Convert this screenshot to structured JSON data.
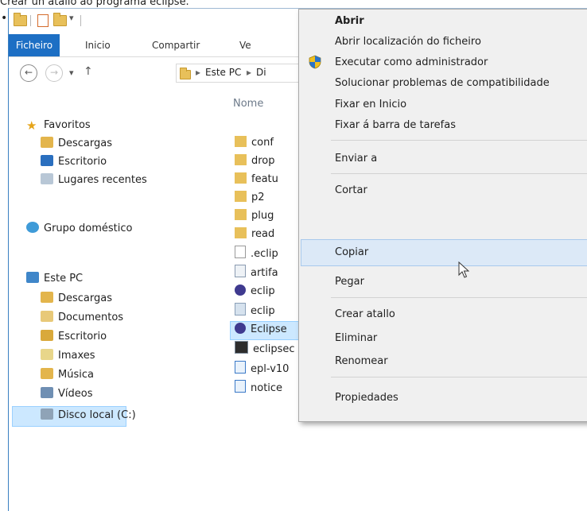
{
  "caption": "Crear un atallo ao programa eclipse.",
  "bullet": "•",
  "ribbon": {
    "tabs": [
      "Ficheiro",
      "Inicio",
      "Compartir",
      "Ve"
    ]
  },
  "address": {
    "segments": [
      "Este PC",
      "Di"
    ]
  },
  "nav": {
    "favorites": "Favoritos",
    "favorites_items": [
      "Descargas",
      "Escritorio",
      "Lugares recentes"
    ],
    "homegroup": "Grupo doméstico",
    "thispc": "Este PC",
    "thispc_items": [
      "Descargas",
      "Documentos",
      "Escritorio",
      "Imaxes",
      "Música",
      "Vídeos",
      "Disco local (C:)"
    ]
  },
  "files": {
    "column_header": "Nome",
    "items": [
      "conf",
      "drop",
      "featu",
      "p2",
      "plug",
      "read",
      ".eclip",
      "artifa",
      "eclip",
      "eclip",
      "Eclipse",
      "eclipsec",
      "epl-v10",
      "notice"
    ]
  },
  "menu": {
    "items": [
      "Abrir",
      "Abrir localización do ficheiro",
      "Executar como administrador",
      "Solucionar problemas de compatibilidade",
      "Fixar en Inicio",
      "Fixar á barra de tarefas",
      "Enviar a",
      "Cortar",
      "Copiar",
      "Pegar",
      "Crear atallo",
      "Eliminar",
      "Renomear",
      "Propiedades"
    ],
    "highlighted": "Copiar"
  },
  "colors": {
    "accent": "#1d6fc4",
    "selection": "#cce8ff",
    "menu_bg": "#f0f0f0",
    "menu_highlight": "#dce9f7"
  }
}
